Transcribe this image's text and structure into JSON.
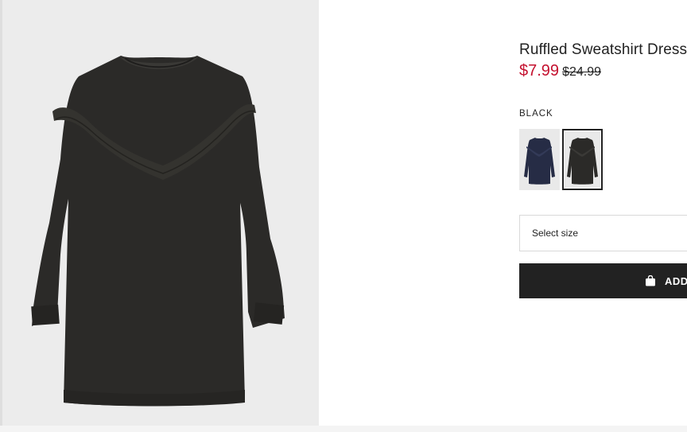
{
  "product": {
    "title": "Ruffled Sweatshirt Dress",
    "price_sale": "$7.99",
    "price_old": "$24.99",
    "image_icon": "dress-photo",
    "color_label": "BLACK",
    "swatches": [
      {
        "name": "navy-blue",
        "color": "#262c45",
        "selected": false
      },
      {
        "name": "black",
        "color": "#2b2a28",
        "selected": true
      }
    ],
    "size_select_label": "Select size",
    "add_button_label": "ADD",
    "add_button_icon": "shopping-bag-icon"
  },
  "colors": {
    "sale": "#c4112f",
    "button_bg": "#222222",
    "image_bg": "#ececec",
    "garment": "#2b2a28"
  }
}
